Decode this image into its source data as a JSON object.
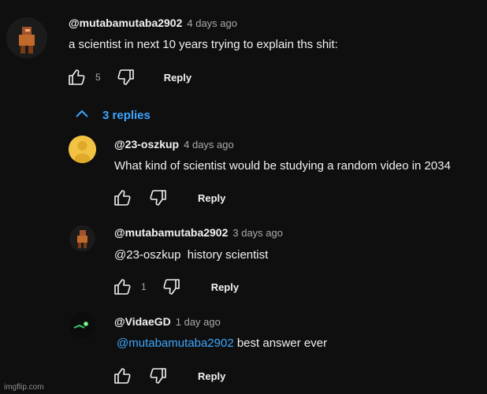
{
  "comment": {
    "author": "@mutabamutaba2902",
    "time": "4 days ago",
    "text": "a scientist in next 10 years trying to explain ths shit:",
    "likes": "5",
    "reply_label": "Reply"
  },
  "replies_toggle": {
    "label": "3 replies"
  },
  "replies": [
    {
      "author": "@23-oszkup",
      "time": "4 days ago",
      "text": "What kind of scientist would be studying a random video in 2034",
      "likes": "",
      "reply_label": "Reply"
    },
    {
      "author": "@mutabamutaba2902",
      "time": "3 days ago",
      "text": "@23-oszkup  history scientist",
      "likes": "1",
      "reply_label": "Reply"
    },
    {
      "author": "@VidaeGD",
      "time": "1 day ago",
      "mention": "@mutabamutaba2902",
      "text": " best answer ever",
      "likes": "",
      "reply_label": "Reply"
    }
  ],
  "watermark": "imgflip.com",
  "colors": {
    "background": "#0f0f0f",
    "link": "#3ea6ff",
    "muted": "#aaaaaa",
    "avatar_yellow": "#f2c343"
  }
}
